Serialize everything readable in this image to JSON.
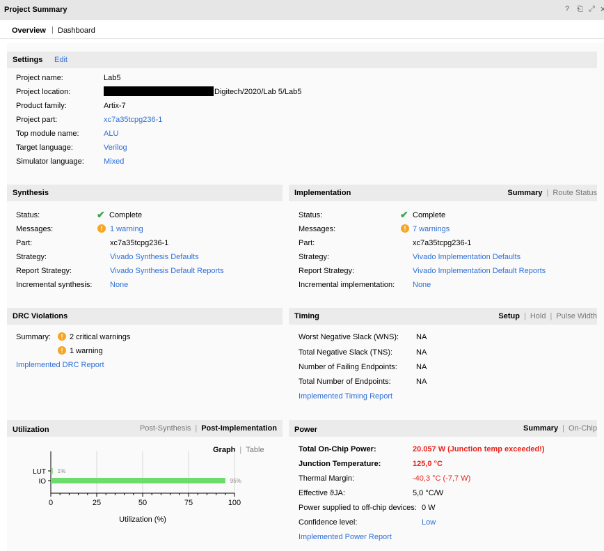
{
  "window": {
    "title": "Project Summary",
    "buttons": [
      "?",
      "⎗",
      "⤢",
      "✕"
    ]
  },
  "tabs": {
    "active": "Overview",
    "other": "Dashboard",
    "separator": "|"
  },
  "settings": {
    "title": "Settings",
    "edit": "Edit",
    "rows": [
      {
        "label": "Project name:",
        "value": "Lab5"
      },
      {
        "label": "Project location:",
        "value": "Digitech/2020/Lab 5/Lab5"
      },
      {
        "label": "Product family:",
        "value": "Artix-7"
      },
      {
        "label": "Project part:",
        "value": "xc7a35tcpg236-1"
      },
      {
        "label": "Top module name:",
        "value": "ALU"
      },
      {
        "label": "Target language:",
        "value": "Verilog"
      },
      {
        "label": "Simulator language:",
        "value": "Mixed"
      }
    ]
  },
  "synthesis": {
    "title": "Synthesis",
    "rows": [
      {
        "label": "Status:",
        "value": "Complete"
      },
      {
        "label": "Messages:",
        "value": "1 warning"
      },
      {
        "label": "Part:",
        "value": "xc7a35tcpg236-1"
      },
      {
        "label": "Strategy:",
        "value": "Vivado Synthesis Defaults"
      },
      {
        "label": "Report Strategy:",
        "value": "Vivado Synthesis Default Reports"
      },
      {
        "label": "Incremental synthesis:",
        "value": "None"
      }
    ]
  },
  "implementation": {
    "title": "Implementation",
    "tab_on": "Summary",
    "tab_off": "Route Status",
    "rows": [
      {
        "label": "Status:",
        "value": "Complete"
      },
      {
        "label": "Messages:",
        "value": "7 warnings"
      },
      {
        "label": "Part:",
        "value": "xc7a35tcpg236-1"
      },
      {
        "label": "Strategy:",
        "value": "Vivado Implementation Defaults"
      },
      {
        "label": "Report Strategy:",
        "value": "Vivado Implementation Default Reports"
      },
      {
        "label": "Incremental implementation:",
        "value": "None"
      }
    ]
  },
  "drc": {
    "title": "DRC Violations",
    "summary_label": "Summary:",
    "critical": "2 critical warnings",
    "warning": "1 warning",
    "report_link": "Implemented DRC Report"
  },
  "timing": {
    "title": "Timing",
    "tab_on": "Setup",
    "tab_hold": "Hold",
    "tab_pulse": "Pulse Width",
    "rows": [
      {
        "label": "Worst Negative Slack (WNS):",
        "value": "NA"
      },
      {
        "label": "Total Negative Slack (TNS):",
        "value": "NA"
      },
      {
        "label": "Number of Failing Endpoints:",
        "value": "NA"
      },
      {
        "label": "Total Number of Endpoints:",
        "value": "NA"
      }
    ],
    "report_link": "Implemented Timing Report"
  },
  "utilization": {
    "title": "Utilization",
    "tab_post_synth": "Post-Synthesis",
    "tab_post_impl": "Post-Implementation",
    "view_graph": "Graph",
    "view_table": "Table"
  },
  "power": {
    "title": "Power",
    "tab_on": "Summary",
    "tab_off": "On-Chip",
    "rows": [
      {
        "label": "Total On-Chip Power:",
        "value": "20.057 W (Junction temp exceeded!)"
      },
      {
        "label": "Junction Temperature:",
        "value": "125,0 °C"
      },
      {
        "label": "Thermal Margin:",
        "value": "-40,3 °C (-7,7 W)"
      },
      {
        "label": "Effective ϑJA:",
        "value": "5,0 °C/W"
      },
      {
        "label": "Power supplied to off-chip devices:",
        "value": "0 W"
      },
      {
        "label": "Confidence level:",
        "value": "Low"
      }
    ],
    "report_link": "Implemented Power Report"
  },
  "chart_data": {
    "type": "bar",
    "orientation": "horizontal",
    "categories": [
      "LUT",
      "IO"
    ],
    "values": [
      1,
      95
    ],
    "value_labels": [
      "1%",
      "95%"
    ],
    "xlabel": "Utilization (%)",
    "ylabel": "",
    "xlim": [
      0,
      100
    ],
    "xticks": [
      "0",
      "25",
      "50",
      "75",
      "100"
    ],
    "bar_color": "#6ddc6d",
    "grid": true
  },
  "colors": {
    "link": "#2e6fd6",
    "error": "#e8231b",
    "ok": "#3aa54a",
    "warning": "#f5a623"
  }
}
